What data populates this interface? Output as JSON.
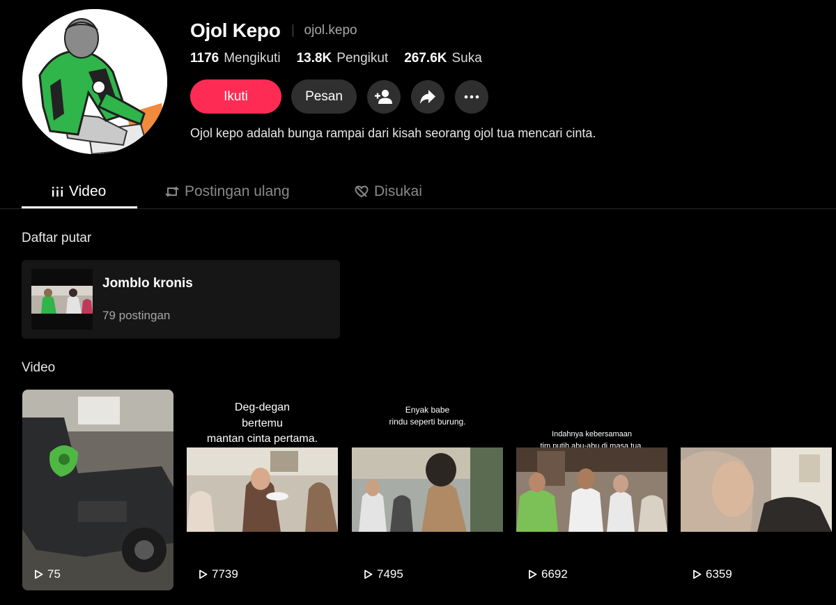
{
  "profile": {
    "display_name": "Ojol Kepo",
    "username": "ojol.kepo",
    "bio": "Ojol kepo adalah bunga rampai dari kisah seorang ojol tua mencari cinta.",
    "avatar_icon": "avatar-illustration"
  },
  "stats": [
    {
      "value": "1176",
      "label": "Mengikuti"
    },
    {
      "value": "13.8K",
      "label": "Pengikut"
    },
    {
      "value": "267.6K",
      "label": "Suka"
    }
  ],
  "actions": {
    "follow_label": "Ikuti",
    "message_label": "Pesan",
    "icons": [
      "add-friend-icon",
      "share-icon",
      "more-icon"
    ]
  },
  "tabs": [
    {
      "label": "Video",
      "icon": "grid-icon",
      "active": true
    },
    {
      "label": "Postingan ulang",
      "icon": "repost-icon",
      "active": false
    },
    {
      "label": "Disukai",
      "icon": "heart-hidden-icon",
      "active": false
    }
  ],
  "playlist_section": {
    "title": "Daftar putar",
    "name": "Jomblo kronis",
    "count": "79 postingan"
  },
  "video_section": {
    "title": "Video",
    "videos": [
      {
        "views": "75",
        "caption": []
      },
      {
        "views": "7739",
        "caption": [
          "Deg-degan",
          "bertemu",
          "mantan cinta pertama."
        ]
      },
      {
        "views": "7495",
        "caption": [
          "Enyak babe",
          "rindu seperti burung."
        ]
      },
      {
        "views": "6692",
        "caption": [
          "Indahnya kebersamaan",
          "tim putih abu-abu di masa tua."
        ]
      },
      {
        "views": "6359",
        "caption": []
      }
    ]
  },
  "colors": {
    "background": "#000000",
    "accent": "#fe2c55",
    "button_secondary": "#2f2f2f",
    "muted_text": "#a9a9a9"
  }
}
